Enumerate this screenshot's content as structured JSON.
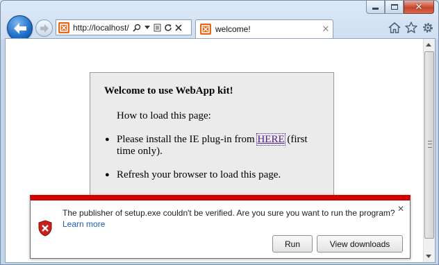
{
  "window": {
    "controls": {
      "minimize_icon": "minimize-icon",
      "maximize_icon": "maximize-icon",
      "close_icon": "close-icon"
    }
  },
  "toolbar": {
    "address": "http://localhost/",
    "tab_title": "welcome!",
    "tab_close": "✕",
    "icons": [
      "back-arrow-icon",
      "forward-arrow-icon",
      "search-icon",
      "dropdown-icon",
      "compatibility-icon",
      "refresh-icon",
      "stop-icon",
      "home-icon",
      "favorites-star-icon",
      "tools-gear-icon"
    ]
  },
  "page": {
    "title": "Welcome to use WebApp kit!",
    "intro": "How to load this page:",
    "bullets": [
      {
        "before": "Please install the IE plug-in from ",
        "link": "HERE",
        "after": " (first time only)."
      },
      {
        "text": "Refresh your browser to load this page."
      }
    ]
  },
  "notification": {
    "message": "The publisher of setup.exe couldn't be verified. Are you sure you want to run the program?",
    "learn_more": "Learn more",
    "close": "✕",
    "buttons": {
      "run": "Run",
      "view_downloads": "View downloads"
    },
    "accent_color": "#d00000"
  }
}
